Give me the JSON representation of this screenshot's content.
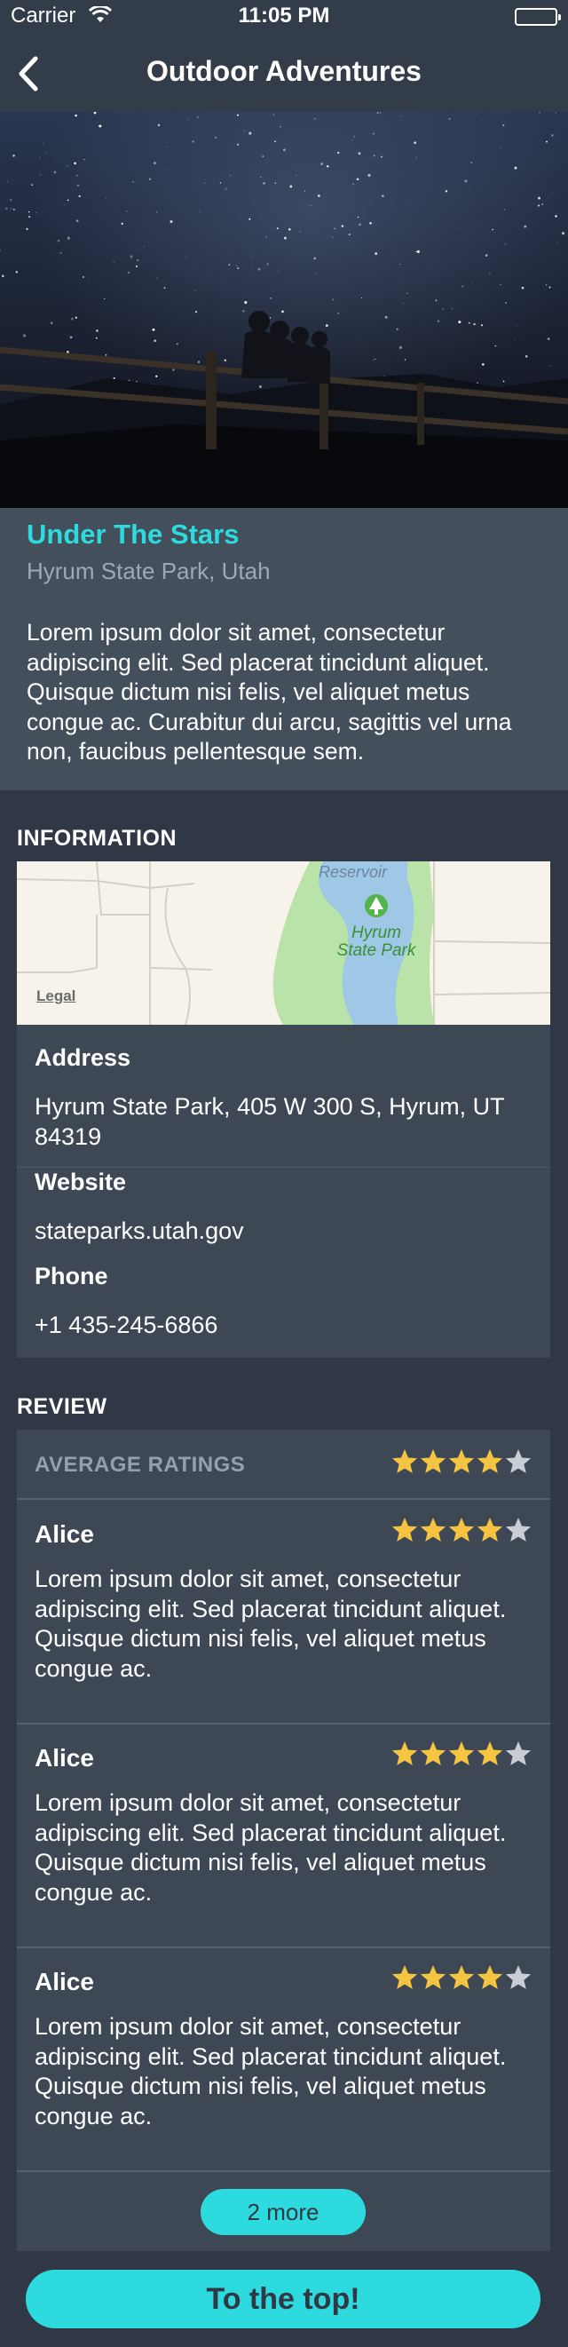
{
  "status_bar": {
    "carrier": "Carrier",
    "time": "11:05 PM"
  },
  "nav": {
    "title": "Outdoor Adventures",
    "back_icon": "chevron-left-icon"
  },
  "hero": {
    "image": "night-sky-people-on-fence"
  },
  "intro": {
    "name": "Under The Stars",
    "place": "Hyrum State Park, Utah",
    "description": "Lorem ipsum dolor sit amet, consectetur adipiscing elit. Sed placerat tincidunt aliquet. Quisque dictum nisi felis, vel aliquet metus congue ac. Curabitur dui arcu, sagittis vel urna non, faucibus pellentesque sem."
  },
  "information": {
    "heading": "INFORMATION",
    "map": {
      "reservoir_label": "Reservoir",
      "park_label_1": "Hyrum",
      "park_label_2": "State Park",
      "legal": "Legal"
    },
    "address_label": "Address",
    "address": "Hyrum State Park, 405 W 300 S, Hyrum, UT 84319",
    "website_label": "Website",
    "website": "stateparks.utah.gov",
    "phone_label": "Phone",
    "phone": "+1 435-245-6866"
  },
  "review": {
    "heading": "REVIEW",
    "average_label": "AVERAGE RATINGS",
    "average_rating": 4,
    "max_rating": 5,
    "items": [
      {
        "name": "Alice",
        "rating": 4,
        "text": "Lorem ipsum dolor sit amet, consectetur adipiscing elit. Sed placerat tincidunt aliquet. Quisque dictum nisi felis, vel aliquet metus congue ac."
      },
      {
        "name": "Alice",
        "rating": 4,
        "text": "Lorem ipsum dolor sit amet, consectetur adipiscing elit. Sed placerat tincidunt aliquet. Quisque dictum nisi felis, vel aliquet metus congue ac."
      },
      {
        "name": "Alice",
        "rating": 4,
        "text": "Lorem ipsum dolor sit amet, consectetur adipiscing elit. Sed placerat tincidunt aliquet. Quisque dictum nisi felis, vel aliquet metus congue ac."
      }
    ],
    "more_label": "2 more"
  },
  "footer": {
    "top_button": "To the top!"
  },
  "colors": {
    "accent": "#2ddbde",
    "background": "#2f3844",
    "card": "#3e4855",
    "star_on": "#f5c542",
    "star_off": "#c9ced6"
  }
}
